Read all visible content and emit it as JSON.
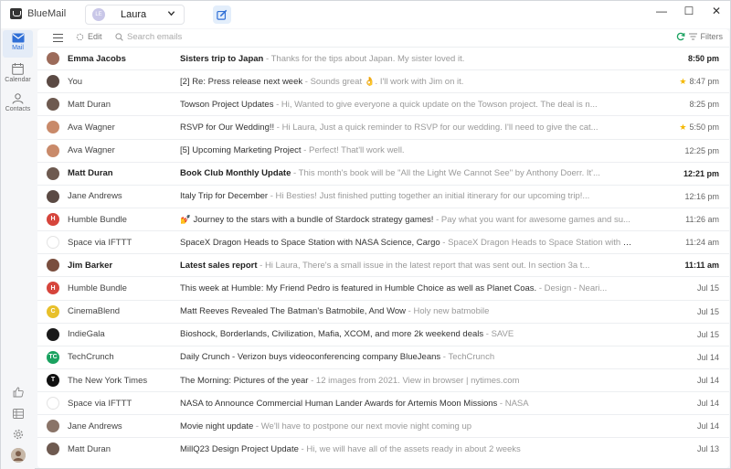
{
  "app": {
    "title": "BlueMail"
  },
  "account": {
    "name": "Laura",
    "initials": "LE"
  },
  "window_controls": {
    "minimize": "—",
    "maximize": "☐",
    "close": "✕"
  },
  "rail": {
    "items": [
      {
        "label": "Mail",
        "icon": "mail-icon",
        "active": true
      },
      {
        "label": "Calendar",
        "icon": "calendar-icon",
        "active": false
      },
      {
        "label": "Contacts",
        "icon": "contacts-icon",
        "active": false
      }
    ],
    "bottom": [
      "thumbs-up-icon",
      "list-icon",
      "gear-icon",
      "user-avatar"
    ]
  },
  "toolbar": {
    "edit_label": "Edit",
    "search_placeholder": "Search emails",
    "filters_label": "Filters"
  },
  "colors": {
    "accent": "#2f6fd6",
    "star": "#f5b800"
  },
  "emails": [
    {
      "sender": "Emma Jacobs",
      "subject": "Sisters trip to Japan",
      "preview": "Thanks for the tips about Japan. My sister loved it.",
      "date": "8:50 pm",
      "unread": true,
      "starred": false,
      "avatar_color": "#9c6b5a",
      "avatar_text": ""
    },
    {
      "sender": "You",
      "subject": "[2] Re: Press release next week",
      "preview": "Sounds great 👌. I'll work with Jim on it.",
      "date": "8:47 pm",
      "unread": false,
      "starred": true,
      "avatar_color": "#5b4a44",
      "avatar_text": ""
    },
    {
      "sender": "Matt Duran",
      "subject": "Towson Project Updates",
      "preview": "Hi, Wanted to give everyone a quick update on the Towson project. The deal is n...",
      "date": "8:25 pm",
      "unread": false,
      "starred": false,
      "avatar_color": "#6e5a50",
      "avatar_text": ""
    },
    {
      "sender": "Ava Wagner",
      "subject": "RSVP for Our Wedding!!",
      "preview": "Hi Laura, Just a quick reminder to RSVP for our wedding. I'll need to give the cat...",
      "date": "5:50 pm",
      "unread": false,
      "starred": true,
      "avatar_color": "#c98a6a",
      "avatar_text": ""
    },
    {
      "sender": "Ava Wagner",
      "subject": "[5] Upcoming Marketing Project",
      "preview": "Perfect! That'll work well.",
      "date": "12:25 pm",
      "unread": false,
      "starred": false,
      "avatar_color": "#c98a6a",
      "avatar_text": ""
    },
    {
      "sender": "Matt Duran",
      "subject": "Book Club Monthly Update",
      "preview": "This month's book will be \"All the Light We Cannot See\" by Anthony Doerr. It'...",
      "date": "12:21 pm",
      "unread": true,
      "starred": false,
      "avatar_color": "#6e5a50",
      "avatar_text": ""
    },
    {
      "sender": "Jane Andrews",
      "subject": "Italy Trip for December",
      "preview": "Hi Besties! Just finished putting together an initial itinerary for our upcoming trip!...",
      "date": "12:16 pm",
      "unread": false,
      "starred": false,
      "avatar_color": "#5b4a44",
      "avatar_text": ""
    },
    {
      "sender": "Humble Bundle",
      "subject": "💅 Journey to the stars with a bundle of Stardock strategy games!",
      "preview": "Pay what you want for awesome games and su...",
      "date": "11:26 am",
      "unread": false,
      "starred": false,
      "avatar_color": "#d6453c",
      "avatar_text": "H"
    },
    {
      "sender": "Space via IFTTT",
      "subject": "SpaceX Dragon Heads to Space Station with NASA Science, Cargo",
      "preview": "SpaceX Dragon Heads to Space Station with NA...",
      "date": "11:24 am",
      "unread": false,
      "starred": false,
      "avatar_color": "#ffffff",
      "avatar_text": ""
    },
    {
      "sender": "Jim Barker",
      "subject": "Latest sales report",
      "preview": "Hi Laura, There's a small issue in the latest report that was sent out. In section 3a t...",
      "date": "11:11 am",
      "unread": true,
      "starred": false,
      "avatar_color": "#7a4e3e",
      "avatar_text": ""
    },
    {
      "sender": "Humble Bundle",
      "subject": "This week at Humble: My Friend Pedro is featured in Humble Choice as well as Planet Coas.",
      "preview": "Design - Neari...",
      "date": "Jul 15",
      "unread": false,
      "starred": false,
      "avatar_color": "#d6453c",
      "avatar_text": "H"
    },
    {
      "sender": "CinemaBlend",
      "subject": "Matt Reeves Revealed The Batman's Batmobile, And Wow",
      "preview": "Holy new batmobile",
      "date": "Jul 15",
      "unread": false,
      "starred": false,
      "avatar_color": "#e8c02a",
      "avatar_text": "C"
    },
    {
      "sender": "IndieGala",
      "subject": "Bioshock, Borderlands, Civilization, Mafia, XCOM, and more 2k weekend deals",
      "preview": "SAVE",
      "date": "Jul 15",
      "unread": false,
      "starred": false,
      "avatar_color": "#1a1a1a",
      "avatar_text": ""
    },
    {
      "sender": "TechCrunch",
      "subject": "Daily Crunch - Verizon buys videoconferencing company BlueJeans",
      "preview": "TechCrunch",
      "date": "Jul 14",
      "unread": false,
      "starred": false,
      "avatar_color": "#1aa260",
      "avatar_text": "TC"
    },
    {
      "sender": "The New York Times",
      "subject": "The Morning: Pictures of the year",
      "preview": "12 images from 2021. View in browser | nytimes.com",
      "date": "Jul 14",
      "unread": false,
      "starred": false,
      "avatar_color": "#111111",
      "avatar_text": "T"
    },
    {
      "sender": "Space via IFTTT",
      "subject": "NASA to Announce Commercial Human Lander Awards for Artemis Moon Missions",
      "preview": "NASA",
      "date": "Jul 14",
      "unread": false,
      "starred": false,
      "avatar_color": "#ffffff",
      "avatar_text": ""
    },
    {
      "sender": "Jane Andrews",
      "subject": "Movie night update",
      "preview": "We'll have to postpone our next movie night coming up",
      "date": "Jul 14",
      "unread": false,
      "starred": false,
      "avatar_color": "#8a7468",
      "avatar_text": ""
    },
    {
      "sender": "Matt Duran",
      "subject": "MillQ23 Design Project Update",
      "preview": "Hi, we will have all of the assets ready in about 2 weeks",
      "date": "Jul 13",
      "unread": false,
      "starred": false,
      "avatar_color": "#6e5a50",
      "avatar_text": ""
    }
  ]
}
